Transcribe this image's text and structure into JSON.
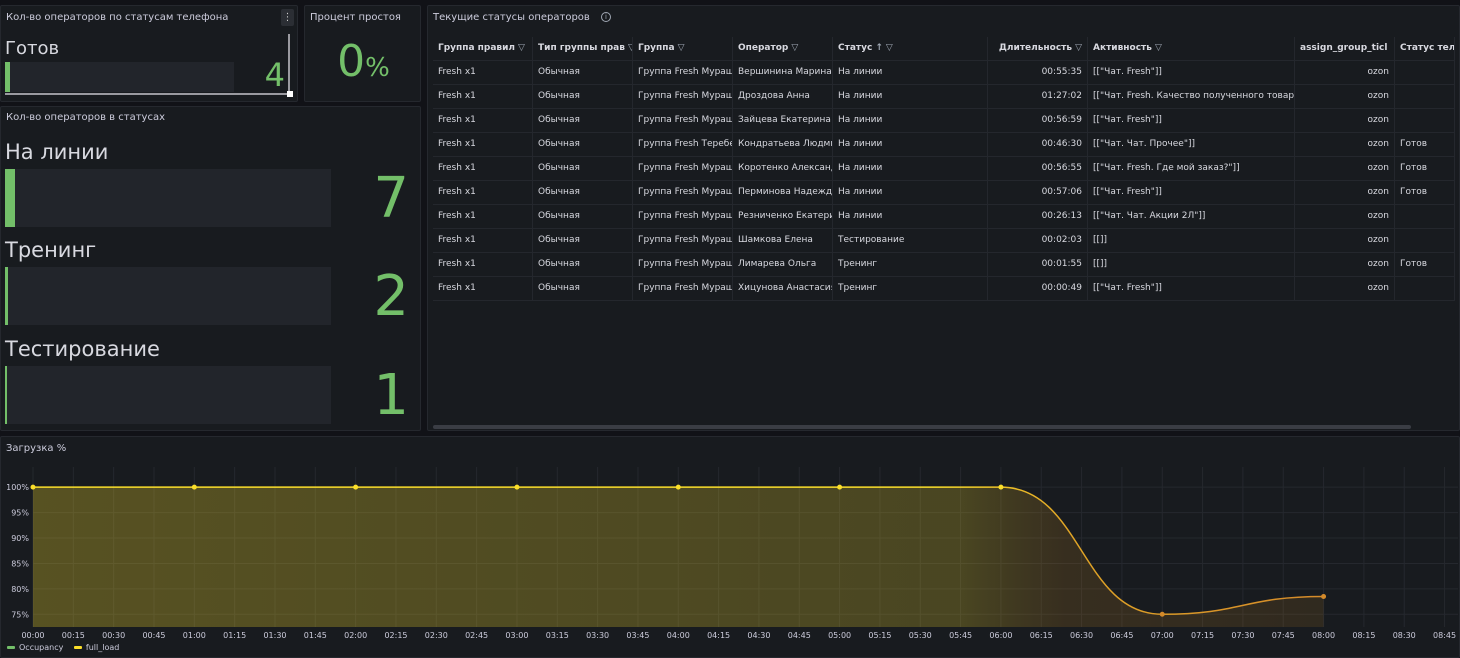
{
  "panel_phone": {
    "title": "Кол-во операторов по статусам телефона",
    "menu_label": "⋮",
    "status_label": "Готов",
    "value": "4",
    "fill_fraction": 0.02
  },
  "panel_idle": {
    "title": "Процент простоя",
    "value": "0",
    "unit": "%"
  },
  "panel_status_count": {
    "title": "Кол-во операторов в статусах",
    "items": [
      {
        "label": "На линии",
        "value": "7",
        "fill_fraction": 0.03
      },
      {
        "label": "Тренинг",
        "value": "2",
        "fill_fraction": 0.01
      },
      {
        "label": "Тестирование",
        "value": "1",
        "fill_fraction": 0.005
      }
    ]
  },
  "panel_table": {
    "title": "Текущие статусы операторов",
    "info_icon": "info-icon",
    "filter_icon": "filter-icon",
    "sort_icon": "sort-ascending-icon",
    "columns": [
      "Группа правил",
      "Тип группы прав",
      "Группа",
      "Оператор",
      "Статус",
      "Длительность",
      "Активность",
      "assign_group_ticl",
      "Статус теле"
    ],
    "rows": [
      [
        "Fresh x1",
        "Обычная",
        "Группа Fresh Мураш",
        "Вершинина Марина",
        "На линии",
        "00:55:35",
        "[[\"Чат. Fresh\"]]",
        "ozon",
        ""
      ],
      [
        "Fresh x1",
        "Обычная",
        "Группа Fresh Мураш",
        "Дроздова Анна",
        "На линии",
        "01:27:02",
        "[[\"Чат. Fresh. Качество полученного товара",
        "ozon",
        ""
      ],
      [
        "Fresh x1",
        "Обычная",
        "Группа Fresh Мураш",
        "Зайцева Екатерина",
        "На линии",
        "00:56:59",
        "[[\"Чат. Fresh\"]]",
        "ozon",
        ""
      ],
      [
        "Fresh x1",
        "Обычная",
        "Группа Fresh Теребе",
        "Кондратьева Людми",
        "На линии",
        "00:46:30",
        "[[\"Чат. Чат. Прочее\"]]",
        "ozon",
        "Готов"
      ],
      [
        "Fresh x1",
        "Обычная",
        "Группа Fresh Мураш",
        "Коротенко Александ",
        "На линии",
        "00:56:55",
        "[[\"Чат. Fresh. Где мой заказ?\"]]",
        "ozon",
        "Готов"
      ],
      [
        "Fresh x1",
        "Обычная",
        "Группа Fresh Мураш",
        "Перминова Надежда",
        "На линии",
        "00:57:06",
        "[[\"Чат. Fresh\"]]",
        "ozon",
        "Готов"
      ],
      [
        "Fresh x1",
        "Обычная",
        "Группа Fresh Мураш",
        "Резниченко Екатери",
        "На линии",
        "00:26:13",
        "[[\"Чат. Чат. Акции 2Л\"]]",
        "ozon",
        ""
      ],
      [
        "Fresh x1",
        "Обычная",
        "Группа Fresh Мураш",
        "Шамкова Елена",
        "Тестирование",
        "00:02:03",
        "[[]]",
        "ozon",
        ""
      ],
      [
        "Fresh x1",
        "Обычная",
        "Группа Fresh Мураш",
        "Лимарева Ольга",
        "Тренинг",
        "00:01:55",
        "[[]]",
        "ozon",
        "Готов"
      ],
      [
        "Fresh x1",
        "Обычная",
        "Группа Fresh Мураш",
        "Хицунова Анастасия",
        "Тренинг",
        "00:00:49",
        "[[\"Чат. Fresh\"]]",
        "ozon",
        ""
      ]
    ]
  },
  "panel_chart": {
    "title": "Загрузка %",
    "legend": [
      {
        "name": "Occupancy",
        "color": "#73bf69"
      },
      {
        "name": "full_load",
        "color": "#fade2a"
      }
    ]
  },
  "chart_data": {
    "type": "line",
    "title": "Загрузка %",
    "x_ticks": [
      "00:00",
      "00:15",
      "00:30",
      "00:45",
      "01:00",
      "01:15",
      "01:30",
      "01:45",
      "02:00",
      "02:15",
      "02:30",
      "02:45",
      "03:00",
      "03:15",
      "03:30",
      "03:45",
      "04:00",
      "04:15",
      "04:30",
      "04:45",
      "05:00",
      "05:15",
      "05:30",
      "05:45",
      "06:00",
      "06:15",
      "06:30",
      "06:45",
      "07:00",
      "07:15",
      "07:30",
      "07:45",
      "08:00",
      "08:15",
      "08:30",
      "08:45"
    ],
    "y_ticks": [
      "100%",
      "95%",
      "90%",
      "85%",
      "80%",
      "75%"
    ],
    "ylim": [
      72.5,
      102
    ],
    "xlim_minutes": [
      0,
      530
    ],
    "series": [
      {
        "name": "full_load",
        "color": "#fade2a",
        "x": [
          "00:00",
          "01:00",
          "02:00",
          "03:00",
          "04:00",
          "05:00",
          "06:00",
          "07:00",
          "08:00"
        ],
        "y": [
          100,
          100,
          100,
          100,
          100,
          100,
          100,
          75,
          78.5
        ]
      }
    ],
    "grid": true,
    "legend_position": "bottom-left"
  }
}
